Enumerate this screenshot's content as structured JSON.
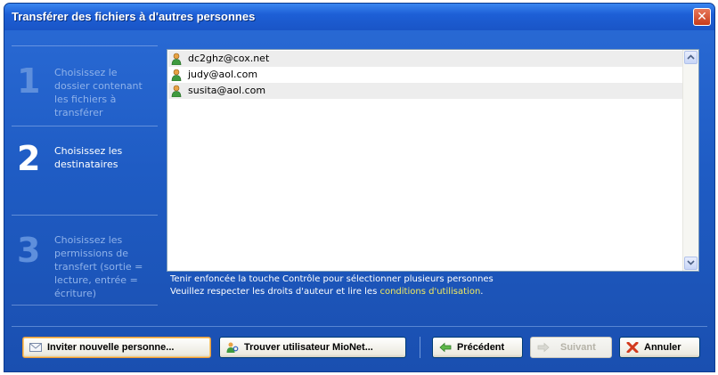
{
  "window": {
    "title": "Transférer des fichiers à d'autres personnes",
    "close_symbol": "✕"
  },
  "steps": [
    {
      "number": "1",
      "label": "Choisissez le dossier contenant les fichiers à transférer",
      "state": "done"
    },
    {
      "number": "2",
      "label": "Choisissez les destinataires",
      "state": "active"
    },
    {
      "number": "3",
      "label": "Choisissez les permissions de transfert (sortie = lecture, entrée = écriture)",
      "state": "pending"
    }
  ],
  "recipients": {
    "items": [
      {
        "email": "dc2ghz@cox.net",
        "icon": "user-icon"
      },
      {
        "email": "judy@aol.com",
        "icon": "user-icon"
      },
      {
        "email": "susita@aol.com",
        "icon": "user-icon"
      }
    ]
  },
  "hints": {
    "multi_select": "Tenir enfoncée la touche Contrôle pour sélectionner plusieurs personnes",
    "copyright_prefix": "Veuillez respecter les droits d'auteur et lire les ",
    "terms_link": "conditions d'utilisation",
    "copyright_suffix": "."
  },
  "buttons": {
    "invite": "Inviter nouvelle personne...",
    "find_user": "Trouver utilisateur MioNet...",
    "previous": "Précédent",
    "next": "Suivant",
    "cancel": "Annuler"
  },
  "colors": {
    "titlebar": "#1d5fd6",
    "panel": "#1f5cc4",
    "link": "#f2ea5e",
    "close": "#c63b1b"
  }
}
